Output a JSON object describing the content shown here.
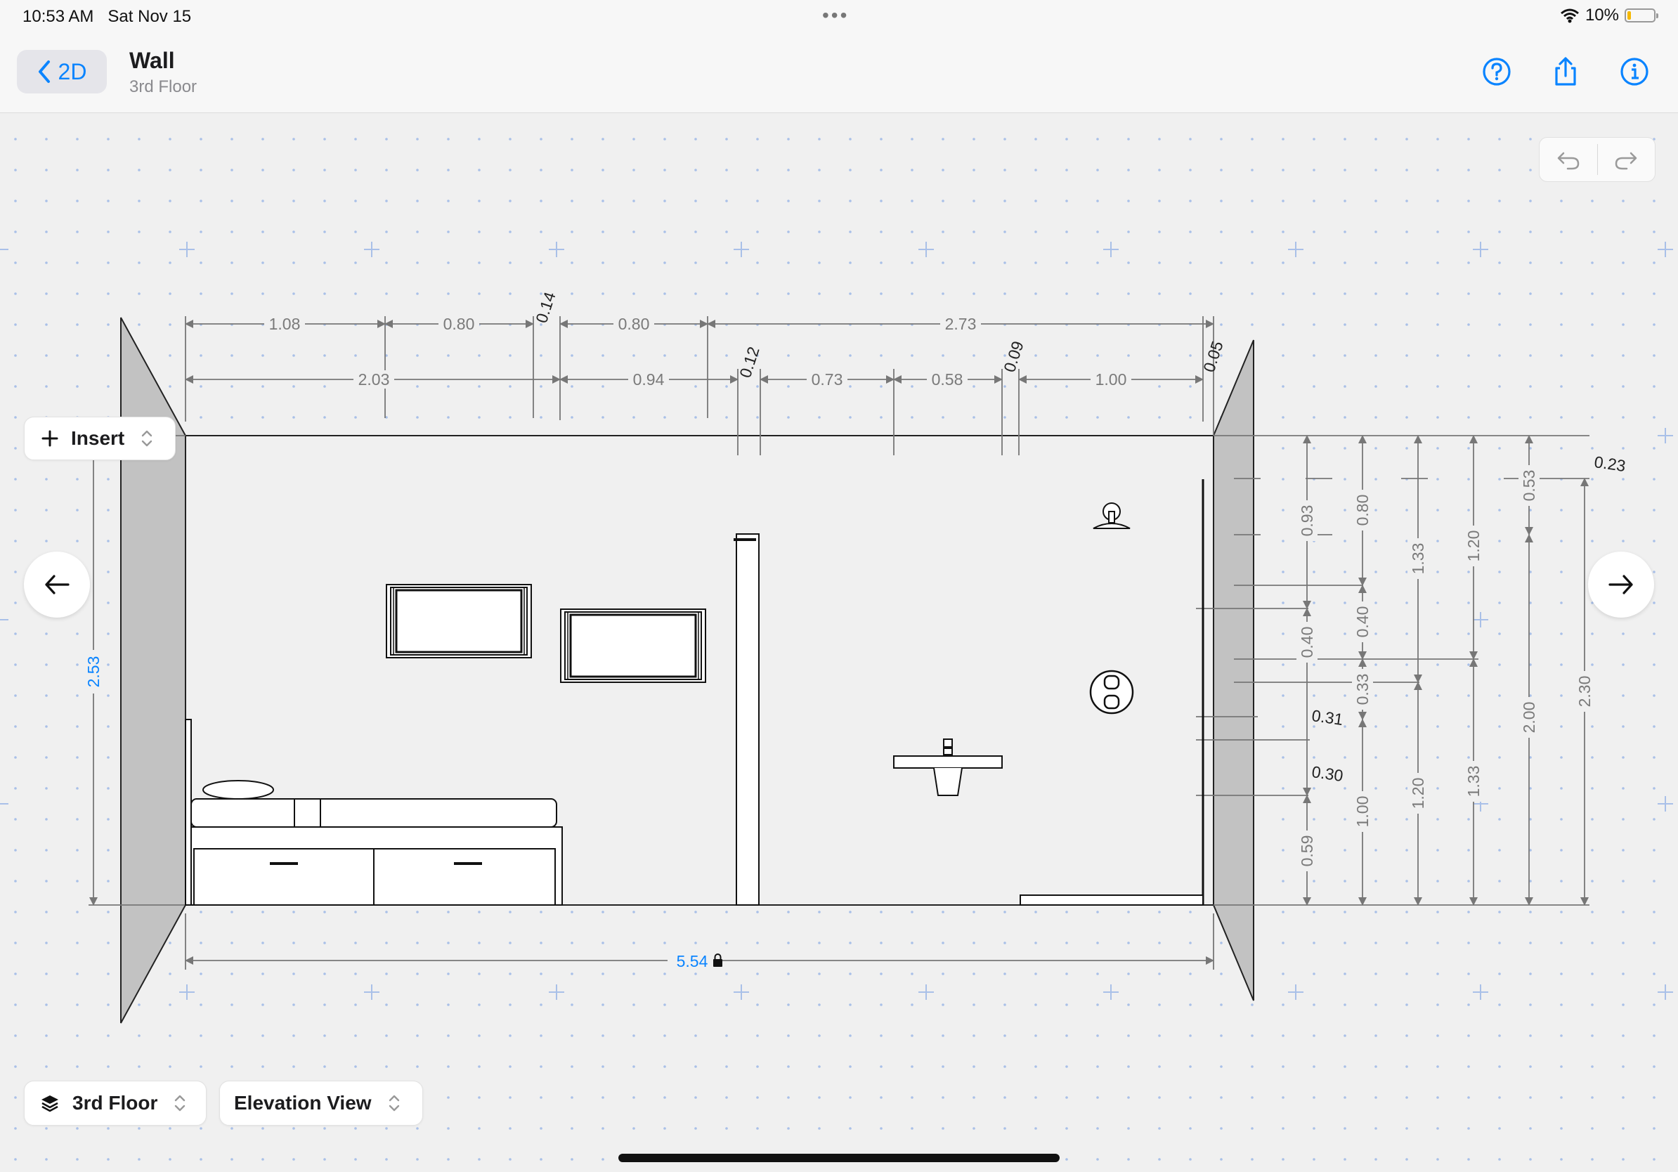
{
  "status_bar": {
    "time": "10:53 AM",
    "date": "Sat Nov 15",
    "battery": "10%",
    "battery_level": 0.1
  },
  "nav": {
    "back_label": "2D",
    "title": "Wall",
    "subtitle": "3rd Floor",
    "icons": [
      "help-icon",
      "share-icon",
      "info-icon"
    ]
  },
  "toolbar": {
    "insert_label": "Insert",
    "floor_label": "3rd Floor",
    "view_label": "Elevation View"
  },
  "drawing": {
    "top_row1": [
      "1.08",
      "0.80",
      "0.14",
      "0.80",
      "2.73"
    ],
    "top_row2": [
      "2.03",
      "0.94",
      "0.12",
      "0.73",
      "0.58",
      "0.09",
      "1.00",
      "0.05"
    ],
    "wall_height": "2.53",
    "wall_width": "5.54",
    "right_col1": [
      "0.93",
      "0.40",
      "0.59"
    ],
    "right_col2": [
      "0.80",
      "0.40",
      "0.33",
      "1.00"
    ],
    "right_col3": [
      "1.33",
      "1.20"
    ],
    "right_col4": [
      "1.20",
      "1.33"
    ],
    "right_col5": [
      "0.53",
      "2.00"
    ],
    "right_col6": [
      "2.30"
    ],
    "right_top": "0.23",
    "offsets": [
      "0.31",
      "0.30"
    ]
  },
  "colors": {
    "accent": "#0a84ff",
    "dimension": "#888888",
    "grid_plus": "#a9c0e8"
  }
}
